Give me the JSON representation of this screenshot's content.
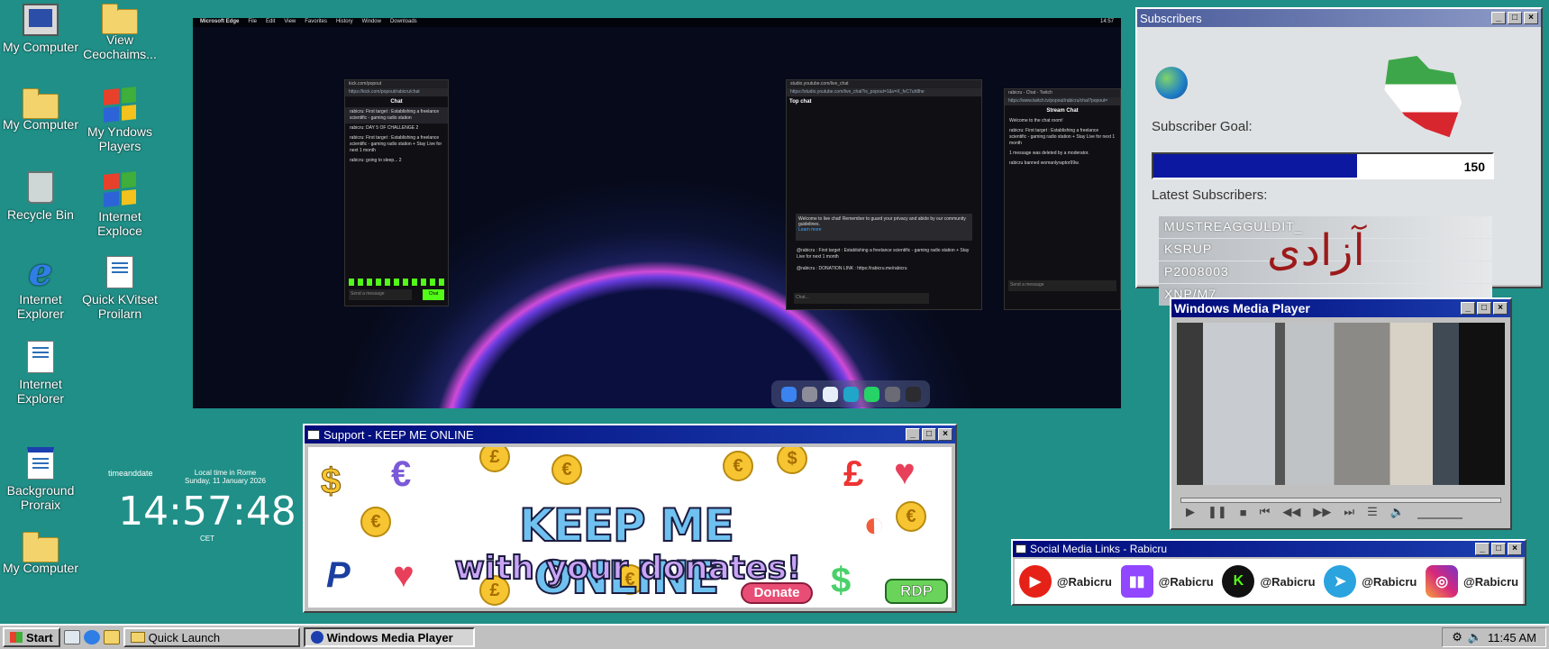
{
  "desktop_icons": [
    {
      "label": "My Computer",
      "icon": "computer-icon"
    },
    {
      "label": "View Ceochaims...",
      "icon": "folder-icon"
    },
    {
      "label": "My Computer",
      "icon": "folder-icon"
    },
    {
      "label": "My Yndows Players",
      "icon": "windows-logo-icon"
    },
    {
      "label": "Recycle Bin",
      "icon": "recycle-bin-icon"
    },
    {
      "label": "Internet Exploce",
      "icon": "windows-logo-icon"
    },
    {
      "label": "Internet Explorer",
      "icon": "internet-explorer-icon"
    },
    {
      "label": "Quick KVitset Proilarn",
      "icon": "document-icon"
    },
    {
      "label": "Internet Explorer",
      "icon": "document-icon"
    },
    {
      "label": "Background Proraix",
      "icon": "window-icon"
    },
    {
      "label": "My Computer",
      "icon": "folder-icon"
    }
  ],
  "browser": {
    "menubar": [
      "Microsoft Edge",
      "File",
      "Edit",
      "View",
      "Favorites",
      "History",
      "Window",
      "Downloads"
    ],
    "clock": "14:57",
    "popup_kick": {
      "url": "https://kick.com/popout/rabicru/chat",
      "header": "Chat",
      "messages": [
        "rabicru: First target : Establishing a freelance scientific - gaming radio station",
        "rabicru: DAY 5 OF CHALLENGE 2",
        "rabicru: First target : Establishing a freelance scientific - gaming radio station + Stay Live for next 1 month",
        "rabicru: going to sleep... 2"
      ],
      "input": "Send a message",
      "send": "Chat"
    },
    "popup_youtube": {
      "url": "https://studio.youtube.com/live_chat?is_popout=1&v=X_fvC7uh8he",
      "header": "Top chat",
      "notice": "Welcome to live chat! Remember to guard your privacy and abide by our community guidelines.",
      "learn": "Learn more",
      "messages": [
        "@rabicru : First target : Establishing a freelance scientific - gaming radio station + Stay Live for next 1 month",
        "@rabicru : DONATION LINK : https://rabicru.me/rabicru"
      ],
      "input": "Chat..."
    },
    "popup_twitch": {
      "url": "https://www.twitch.tv/popout/rabicru/chat?popout=",
      "header": "Stream Chat",
      "messages": [
        "Welcome to the chat room!",
        "rabicru: First target : Establishing a freelance scientific - gaming radio station + Stay Live for next 1 month",
        "1 message was deleted by a moderator.",
        "rabicru banned womanlyraptor99w."
      ],
      "input": "Send a message"
    }
  },
  "subscribers_window": {
    "title": "Subscribers",
    "goal_label": "Subscriber Goal:",
    "goal_value": "150",
    "progress": 0.6,
    "latest_label": "Latest Subscribers:",
    "latest": [
      "MUSTREAGGULDIT_",
      "KSRUP",
      "P2008003",
      "XNP/M7_"
    ],
    "overlay_text": "آزادی"
  },
  "wmp_window": {
    "title": "Windows Media Player"
  },
  "support_window": {
    "title": "Support - KEEP ME ONLINE",
    "headline": "KEEP ME ONLINE",
    "subline": "with your donates!",
    "donate": "Donate",
    "rdp": "RDP"
  },
  "social_window": {
    "title": "Social Media Links - Rabicru",
    "links": [
      {
        "platform": "youtube",
        "handle": "@Rabicru",
        "color": "#e62117"
      },
      {
        "platform": "twitch",
        "handle": "@Rabicru",
        "color": "#9146ff"
      },
      {
        "platform": "kick",
        "handle": "@Rabicru",
        "color": "#53fc18"
      },
      {
        "platform": "telegram",
        "handle": "@Rabicru",
        "color": "#2aa3df"
      },
      {
        "platform": "instagram",
        "handle": "@Rabicru",
        "color": "#d6297a"
      }
    ]
  },
  "clock_widget": {
    "brand": "timeanddate",
    "location": "Local time in Rome",
    "date": "Sunday, 11 January 2026",
    "time": "14:57:48",
    "tz": "CET"
  },
  "taskbar": {
    "start": "Start",
    "quick_launch": "Quick Launch",
    "active": "Windows Media Player",
    "time": "11:45 AM"
  },
  "colors": {
    "desktop": "#1f8f87",
    "title_active": "#000a7a",
    "window_face": "#c0c0c0"
  }
}
